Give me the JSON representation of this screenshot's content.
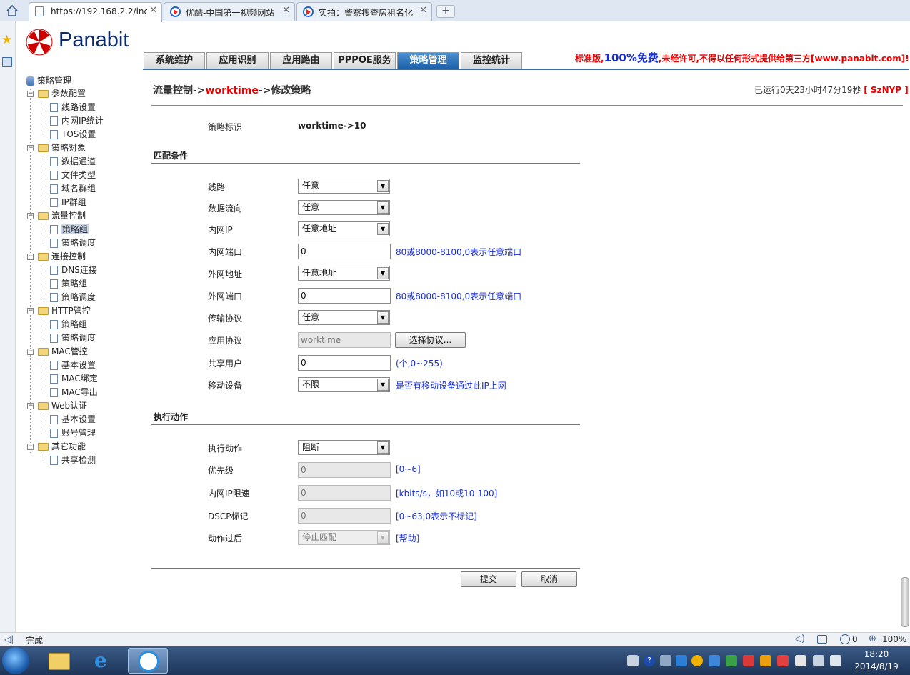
{
  "browser": {
    "tabs": [
      {
        "title": "https://192.168.2.2/inc",
        "icon": "page-icon"
      },
      {
        "title": "优酷-中国第一视频网站",
        "icon": "youku-icon"
      },
      {
        "title": "实拍：警察搜查房租名化",
        "icon": "youku-icon"
      }
    ],
    "new_tab": "+",
    "status": "完成",
    "zoom": "100%",
    "counter": "0"
  },
  "header": {
    "logo": "Panabit",
    "tabs": [
      "系统维护",
      "应用识别",
      "应用路由",
      "PPPOE服务",
      "策略管理",
      "监控统计"
    ],
    "active_tab": "策略管理",
    "notice_a": "标准版,",
    "notice_big": "100%免费",
    "notice_b": ",未经许可,不得以任何形式提供给第三方[www.panabit.com]!"
  },
  "tree": {
    "root": "策略管理",
    "groups": [
      {
        "label": "参数配置",
        "items": [
          "线路设置",
          "内网IP统计",
          "TOS设置"
        ]
      },
      {
        "label": "策略对象",
        "items": [
          "数据通道",
          "文件类型",
          "域名群组",
          "IP群组"
        ]
      },
      {
        "label": "流量控制",
        "items": [
          "策略组",
          "策略调度"
        ]
      },
      {
        "label": "连接控制",
        "items": [
          "DNS连接",
          "策略组",
          "策略调度"
        ]
      },
      {
        "label": "HTTP管控",
        "items": [
          "策略组",
          "策略调度"
        ]
      },
      {
        "label": "MAC管控",
        "items": [
          "基本设置",
          "MAC绑定",
          "MAC导出"
        ]
      },
      {
        "label": "Web认证",
        "items": [
          "基本设置",
          "账号管理"
        ]
      },
      {
        "label": "其它功能",
        "items": [
          "共享检测"
        ]
      }
    ]
  },
  "main": {
    "crumb_a": "流量控制->",
    "crumb_b": "worktime",
    "crumb_c": "->修改策略",
    "uptime": "已运行0天23小时47分19秒",
    "user": "[ SzNYP ]",
    "policy_id_label": "策略标识",
    "policy_id": "worktime->10",
    "match_section": "匹配条件",
    "line_label": "线路",
    "line_value": "任意",
    "direction_label": "数据流向",
    "direction_value": "任意",
    "lan_ip_label": "内网IP",
    "lan_ip_value": "任意地址",
    "lan_port_label": "内网端口",
    "lan_port_value": "0",
    "port_hint": "80或8000-8100,0表示任意端口",
    "wan_addr_label": "外网地址",
    "wan_addr_value": "任意地址",
    "wan_port_label": "外网端口",
    "wan_port_value": "0",
    "proto_label": "传输协议",
    "proto_value": "任意",
    "app_label": "应用协议",
    "app_value": "worktime",
    "app_button": "选择协议...",
    "share_label": "共享用户",
    "share_value": "0",
    "share_hint": "(个,0~255)",
    "mobile_label": "移动设备",
    "mobile_value": "不限",
    "mobile_hint": "是否有移动设备通过此IP上网",
    "action_section": "执行动作",
    "action_label": "执行动作",
    "action_value": "阻断",
    "priority_label": "优先级",
    "priority_value": "0",
    "priority_hint": "[0~6]",
    "rate_label": "内网IP限速",
    "rate_value": "0",
    "rate_hint": "[kbits/s，如10或10-100]",
    "dscp_label": "DSCP标记",
    "dscp_value": "0",
    "dscp_hint": "[0~63,0表示不标记]",
    "after_label": "动作过后",
    "after_value": "停止匹配",
    "after_hint": "[帮助]",
    "submit": "提交",
    "cancel": "取消"
  },
  "taskbar": {
    "time": "18:20",
    "date": "2014/8/19"
  },
  "colors": {
    "accent": "#2f6db3",
    "brand_red": "#e00000",
    "hint_blue": "#1a2fd0"
  }
}
